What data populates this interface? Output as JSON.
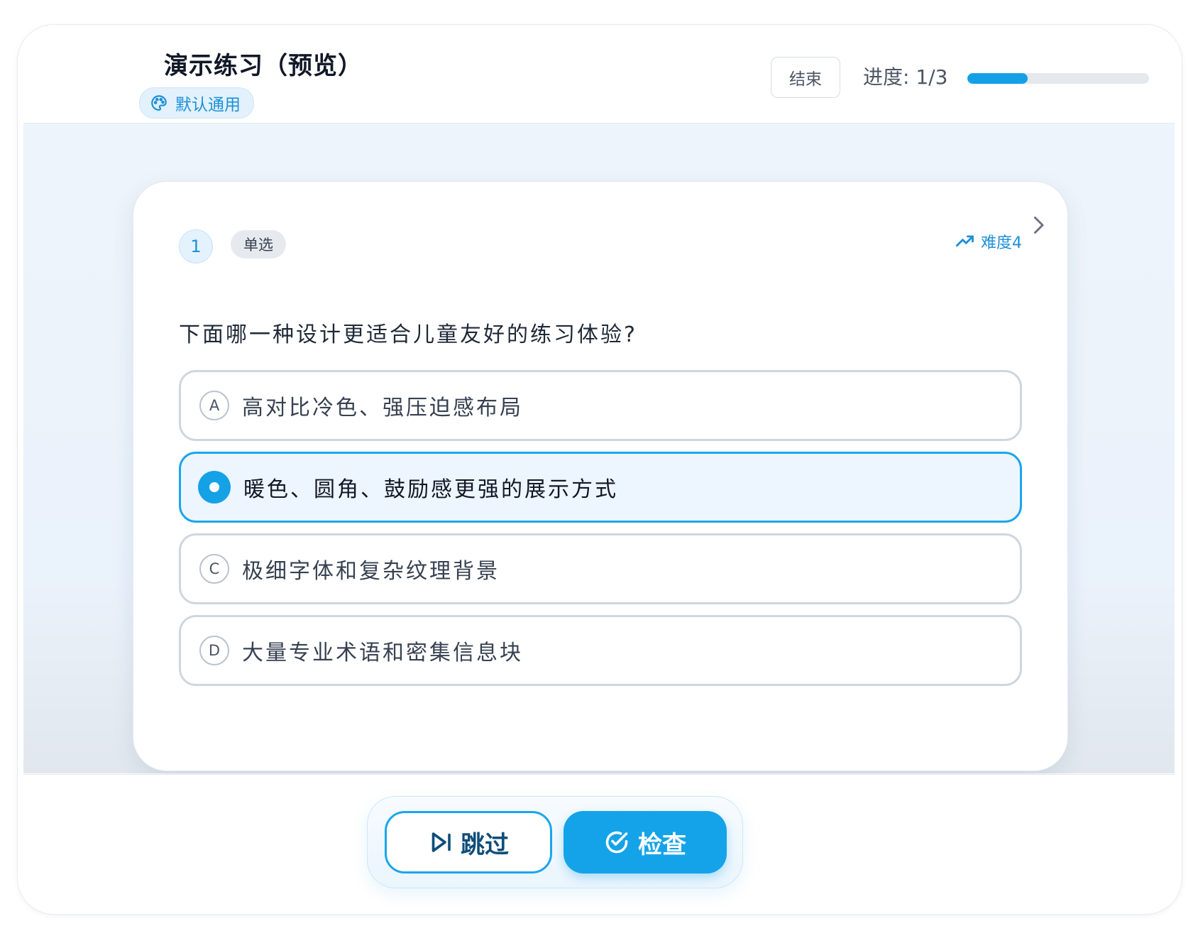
{
  "header": {
    "title": "演示练习（预览）",
    "theme_label": "默认通用",
    "end_label": "结束",
    "progress_label": "进度: 1/3",
    "progress": {
      "current": 1,
      "total": 3
    }
  },
  "question": {
    "number": "1",
    "type": "单选",
    "difficulty": "难度4",
    "text": "下面哪一种设计更适合儿童友好的练习体验?",
    "options": [
      {
        "letter": "A",
        "text": "高对比冷色、强压迫感布局",
        "selected": false
      },
      {
        "letter": "B",
        "text": "暖色、圆角、鼓励感更强的展示方式",
        "selected": true
      },
      {
        "letter": "C",
        "text": "极细字体和复杂纹理背景",
        "selected": false
      },
      {
        "letter": "D",
        "text": "大量专业术语和密集信息块",
        "selected": false
      }
    ]
  },
  "actions": {
    "skip_label": "跳过",
    "check_label": "检查"
  },
  "colors": {
    "accent": "#14a3e8",
    "selected_bg": "#edf5fe",
    "option_border": "#cfd6e0"
  }
}
